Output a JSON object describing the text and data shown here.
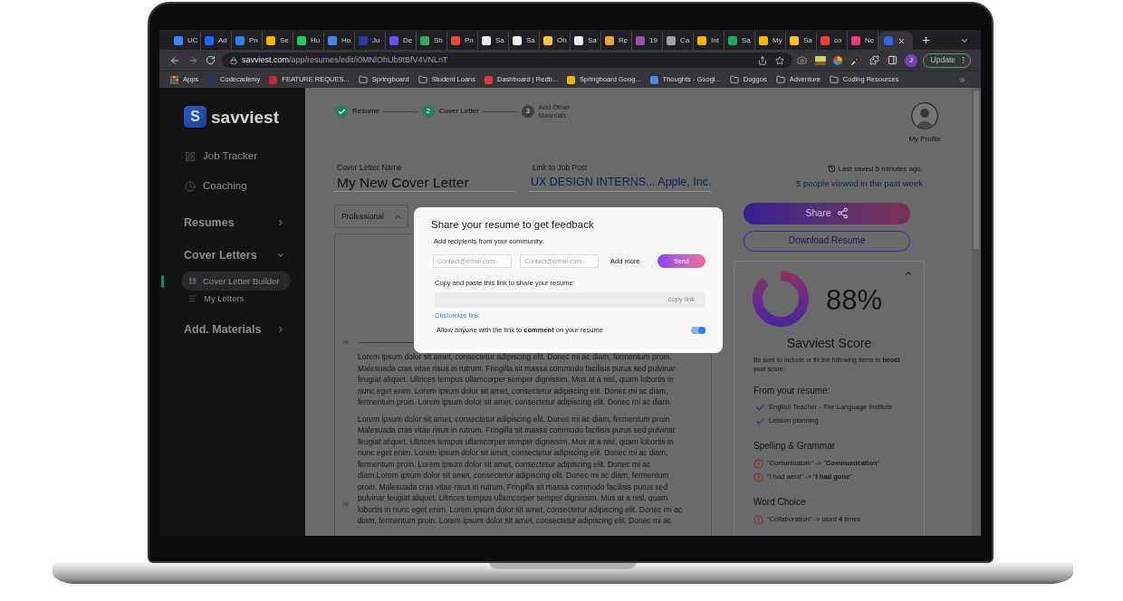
{
  "browser": {
    "tabs": [
      {
        "title": "UC",
        "color": "#4285f4",
        "selected": false
      },
      {
        "title": "Ad",
        "color": "#1769ff",
        "selected": false
      },
      {
        "title": "Pn",
        "color": "#2f80ed",
        "selected": false
      },
      {
        "title": "Se",
        "color": "#f4b400",
        "selected": false
      },
      {
        "title": "Hu",
        "color": "#22c55e",
        "selected": false
      },
      {
        "title": "Ho",
        "color": "#4a86e8",
        "selected": false
      },
      {
        "title": "Ju",
        "color": "#2a3aa8",
        "selected": false
      },
      {
        "title": "De",
        "color": "#6d4bf5",
        "selected": false
      },
      {
        "title": "Sh",
        "color": "#3aa757",
        "selected": false
      },
      {
        "title": "Pn",
        "color": "#e8453c",
        "selected": false
      },
      {
        "title": "Sa",
        "color": "#eeeeee",
        "selected": false
      },
      {
        "title": "Sa",
        "color": "#eeeeee",
        "selected": false
      },
      {
        "title": "Oh",
        "color": "#f5c542",
        "selected": false
      },
      {
        "title": "Sa",
        "color": "#eeeeee",
        "selected": false
      },
      {
        "title": "Re",
        "color": "#e8a33d",
        "selected": false
      },
      {
        "title": "19",
        "color": "#9b4fa8",
        "selected": false
      },
      {
        "title": "Ca",
        "color": "#9aa0a6",
        "selected": false
      },
      {
        "title": "Int",
        "color": "#f4b400",
        "selected": false
      },
      {
        "title": "Sa",
        "color": "#1fa463",
        "selected": false
      },
      {
        "title": "My",
        "color": "#f4b400",
        "selected": false
      },
      {
        "title": "Sa",
        "color": "#f6bf26",
        "selected": false
      },
      {
        "title": "co",
        "color": "#ea4335",
        "selected": false
      },
      {
        "title": "Ne",
        "color": "#e83e6b",
        "selected": false
      },
      {
        "color": "#3464e0",
        "selected": true
      }
    ],
    "url": {
      "domain": "savviest.com",
      "path": "/app/resumes/edit/i0MNlOhUb9tBfV4VNLnT"
    },
    "profile_initial": "J",
    "update_label": "Update",
    "bookmarks": [
      {
        "label": "Apps",
        "kind": "apps"
      },
      {
        "label": "Codecademy",
        "kind": "site",
        "color": "#24366b"
      },
      {
        "label": "FEATURE REQUES...",
        "kind": "site",
        "color": "#c0283c"
      },
      {
        "label": "Springboard",
        "kind": "folder"
      },
      {
        "label": "Student Loans",
        "kind": "folder"
      },
      {
        "label": "Dashboard | Redb...",
        "kind": "site",
        "color": "#e53935"
      },
      {
        "label": "Springboard Goog...",
        "kind": "site",
        "color": "#f4b400"
      },
      {
        "label": "Thoughts - Googl...",
        "kind": "site",
        "color": "#4a86e8"
      },
      {
        "label": "Doggos",
        "kind": "folder"
      },
      {
        "label": "Adventure",
        "kind": "folder"
      },
      {
        "label": "Coding Resources",
        "kind": "folder"
      }
    ]
  },
  "sidebar": {
    "logo": {
      "mark": "S",
      "name": "savviest"
    },
    "links": [
      {
        "label": "Job Tracker"
      },
      {
        "label": "Coaching"
      }
    ],
    "sections": [
      {
        "label": "Resumes",
        "expanded": false
      },
      {
        "label": "Cover Letters",
        "expanded": true,
        "children": [
          {
            "label": "Cover Letter Builder",
            "selected": true
          },
          {
            "label": "My Letters",
            "selected": false
          }
        ]
      },
      {
        "label": "Add. Materials",
        "expanded": false
      }
    ]
  },
  "stepper": [
    {
      "label": "Resume",
      "kind": "done"
    },
    {
      "label": "Cover Letter",
      "number": "2",
      "kind": "current"
    },
    {
      "label": "Add Other Materials",
      "number": "3",
      "kind": "upcoming"
    }
  ],
  "profile": {
    "label": "My Profile"
  },
  "fields": [
    {
      "label": "Cover Letter Name",
      "value": "My New Cover Letter",
      "kind": "text"
    },
    {
      "label": "Link to Job Post",
      "value": "UX DESIGN INTERNS... Apple, Inc.",
      "kind": "link"
    }
  ],
  "save_status": {
    "text": "Last saved 5 minutes ago.",
    "views": "5 people viewed in the past week"
  },
  "style_select": {
    "value": "Professional"
  },
  "document": {
    "paragraphs": [
      "Lorem ipsum dolor sit amet, consectetur adipiscing elit. Donec mi ac diam, fermentum proin. Malesuada cras vitae risus in rutrum. Fringilla sit massa commodo facilisis purus sed pulvinar feugiat aliquet. Ultrices tempus ullamcorper semper dignissim. Mus at a nisl, quam lobortis in nunc eget enim. Lorem ipsum dolor sit amet, consectetur adipiscing elit. Donec mi ac diam, fermentum proin. Lorem ipsum dolor sit amet, consectetur adipiscing elit. Donec mi ac diam.",
      "Lorem ipsum dolor sit amet, consectetur adipiscing elit. Donec mi ac diam, fermentum proin. Malesuada cras vitae risus in rutrum. Fringilla sit massa commodo facilisis purus sed pulvinar feugiat aliquet. Ultrices tempus ullamcorper semper dignissim. Mus at a nisl, quam lobortis in nunc eget enim. Lorem ipsum dolor sit amet, consectetur adipiscing elit. Donec mi ac diam, fermentum proin. Lorem ipsum dolor sit amet, consectetur adipiscing elit. Donec mi ac diam.Lorem ipsum dolor sit amet, consectetur adipiscing elit. Donec mi ac diam, fermentum proin. Malesuada cras vitae risus in rutrum. Fringilla sit massa commodo facilisis purus sed pulvinar feugiat aliquet. Ultrices tempus ullamcorper semper dignissim. Mus at a nisl, quam lobortis in nunc eget enim. Lorem ipsum dolor sit amet, consectetur adipiscing elit. Donec mi ac diam, fermentum proin. Lorem ipsum dolor sit amet, consectetur adipiscing elit. Donec mi ac"
    ]
  },
  "actions": {
    "share": "Share",
    "download": "Download Resume"
  },
  "score": {
    "level": 0.88,
    "value": "88%",
    "title": "Savviest Score",
    "expanded": true,
    "intro": "Be sure to include or fix the following items to **boost** your score:",
    "groups": [
      {
        "title": "From your resume:",
        "items": [
          {
            "text": "English Teacher - The Language Institute",
            "kind": "ok"
          },
          {
            "text": "Lesson planning",
            "kind": "ok"
          }
        ]
      },
      {
        "title": "Spelling & Grammar",
        "items": [
          {
            "text": "\"Comunicatoin\" -> \"**Communication**\"",
            "kind": "issue"
          },
          {
            "text": "\"I had went\" -> \"**I had gone**\"",
            "kind": "issue"
          }
        ]
      },
      {
        "title": "Word Choice",
        "items": [
          {
            "text": "\"Collaboration\" -> used **4** times",
            "kind": "issue"
          }
        ]
      }
    ]
  },
  "modal": {
    "title": "Share your resume to get feedback",
    "recipients_label": "Add recipients from your community:",
    "inputs": [
      {
        "placeholder": "Contact@email.com"
      },
      {
        "placeholder": "Contact@email.com"
      }
    ],
    "add_more": "Add more",
    "send": "Send",
    "link_label": "Copy and paste this link to share your resume:",
    "copy_link": "copy link",
    "customize": "Customize link",
    "comment_toggle": {
      "label": "Allow anyone with the link to **comment** on your resume",
      "on": true
    }
  }
}
